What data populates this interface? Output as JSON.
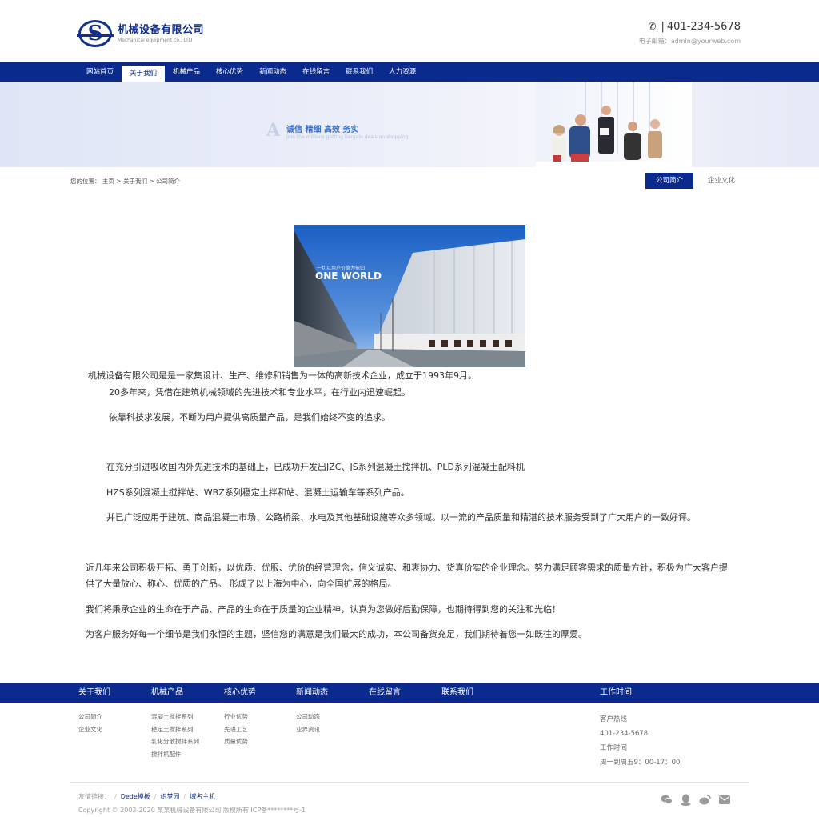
{
  "header": {
    "logo_letter": "S",
    "company_name": "机械设备有限公司",
    "company_en": "Mechanical equipment co., LTD",
    "phone_icon": "phone-icon",
    "phone_sep": "|",
    "phone": "401-234-5678",
    "email_label": "电子邮箱：",
    "email": "admin@yourweb.com"
  },
  "nav": {
    "items": [
      {
        "label": "网站首页"
      },
      {
        "label": "关于我们"
      },
      {
        "label": "机械产品"
      },
      {
        "label": "核心优势"
      },
      {
        "label": "新闻动态"
      },
      {
        "label": "在线留言"
      },
      {
        "label": "联系我们"
      },
      {
        "label": "人力资源"
      }
    ],
    "active": "关于我们"
  },
  "banner": {
    "letter": "A",
    "title": "诚信 精细 高效 务实",
    "subtitle": "Join the millions getting bargain deals on shopping"
  },
  "breadcrumb": {
    "label": "您的位置：",
    "home": "主页",
    "sep": ">",
    "section": "关于我们",
    "page": "公司简介"
  },
  "subtabs": [
    {
      "label": "公司简介",
      "active": true
    },
    {
      "label": "企业文化",
      "active": false
    }
  ],
  "photo": {
    "caption_small": "一切以用户价值为依归",
    "caption_large": "ONE WORLD"
  },
  "content": {
    "p1": "机械设备有限公司是是一家集设计、生产、维修和销售为一体的高新技术企业，成立于1993年9月。",
    "p2": "20多年来，凭借在建筑机械领域的先进技术和专业水平，在行业内迅速崛起。",
    "p3": "依靠科技求发展，不断为用户提供高质量产品，是我们始终不变的追求。",
    "p4": "在充分引进吸收国内外先进技术的基础上，已成功开发出JZC、JS系列混凝土搅拌机、PLD系列混凝土配料机",
    "p5": "HZS系列混凝土搅拌站、WBZ系列稳定土拌和站、混凝土运输车等系列产品。",
    "p6": "并已广泛应用于建筑、商品混凝土市场、公路桥梁、水电及其他基础设施等众多领域。以一流的产品质量和精湛的技术服务受到了广大用户的一致好评。",
    "p7": "近几年来公司积极开拓、勇于创新，以优质、优服、优价的经营理念，信义诚实、和衷协力、货真价实的企业理念。努力满足顾客需求的质量方针，积极为广大客户提供了大量放心、称心、优质的产品。 形成了以上海为中心，向全国扩展的格局。",
    "p8": "我们将秉承企业的生命在于产品、产品的生命在于质量的企业精神，认真为您做好后勤保障，也期待得到您的关注和光临！",
    "p9": "为客户服务好每一个细节是我们永恒的主题，坚信您的满意是我们最大的成功，本公司备货充足，我们期待着您一如既往的厚爱。"
  },
  "footer": {
    "nav": [
      "关于我们",
      "机械产品",
      "核心优势",
      "新闻动态",
      "在线留言",
      "联系我们"
    ],
    "work_title": "工作时间",
    "cols": [
      [
        "公司简介",
        "企业文化"
      ],
      [
        "混凝土搅拌系列",
        "稳定土搅拌系列",
        "乳化分散搅拌系列",
        "搅拌机配件"
      ],
      [
        "行业优势",
        "先进工艺",
        "质量优势"
      ],
      [
        "公司动态",
        "业界资讯"
      ]
    ],
    "hotline_label": "客户热线",
    "hotline": "401-234-5678",
    "hours_label": "工作时间",
    "hours": "周一到周五9：00-17：00",
    "links_label": "友情链接：",
    "links_sep": "/",
    "links": [
      "Dede模板",
      "织梦园",
      "域名主机"
    ],
    "copyright": "Copyright © 2002-2020 某某机械设备有限公司 版权所有 ICP备********号-1",
    "social_icons": [
      "wechat-icon",
      "qq-icon",
      "weibo-icon",
      "mail-icon"
    ]
  },
  "colors": {
    "brand": "#0a2a8e",
    "banner_title": "#3d6fc4"
  }
}
